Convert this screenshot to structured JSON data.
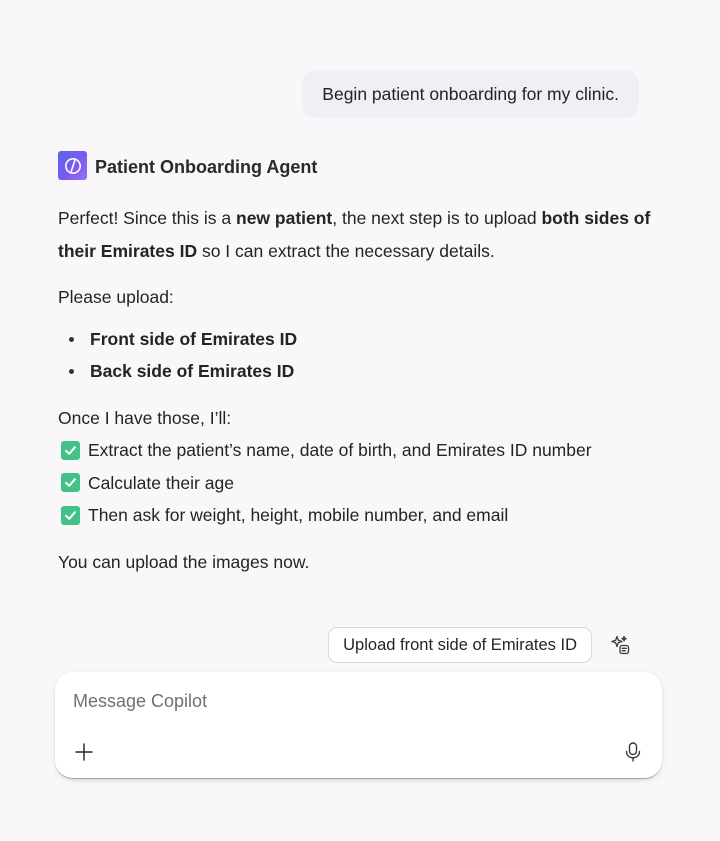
{
  "user_message": "Begin patient onboarding for my clinic.",
  "agent": {
    "name": "Patient Onboarding Agent",
    "logo_icon": "copilot-agent-slash-icon"
  },
  "response": {
    "intro_1": "Perfect! Since this is a ",
    "intro_bold_1": "new patient",
    "intro_2": ", the next step is to upload ",
    "intro_bold_2": "both sides of their Emirates ID",
    "intro_3": " so I can extract the necessary details.",
    "please_upload": "Please upload:",
    "bullets": [
      "Front side of Emirates ID",
      "Back side of Emirates ID"
    ],
    "once_text": "Once I have those, I’ll:",
    "checklist": [
      "Extract the patient’s name, date of birth, and Emirates ID number",
      "Calculate their age",
      "Then ask for weight, height, mobile number, and email"
    ],
    "closing": "You can upload the images now."
  },
  "suggestion": {
    "label": "Upload front side of Emirates ID",
    "icon": "sparkle-suggestions-icon"
  },
  "composer": {
    "placeholder": "Message Copilot",
    "value": "",
    "add_icon": "plus-icon",
    "mic_icon": "microphone-icon"
  },
  "colors": {
    "background": "#f9f7fa",
    "user_bubble": "#f1eef4",
    "check": "#44c08a",
    "logo_gradient_start": "#5b63f0",
    "logo_gradient_end": "#9b6ff2"
  }
}
